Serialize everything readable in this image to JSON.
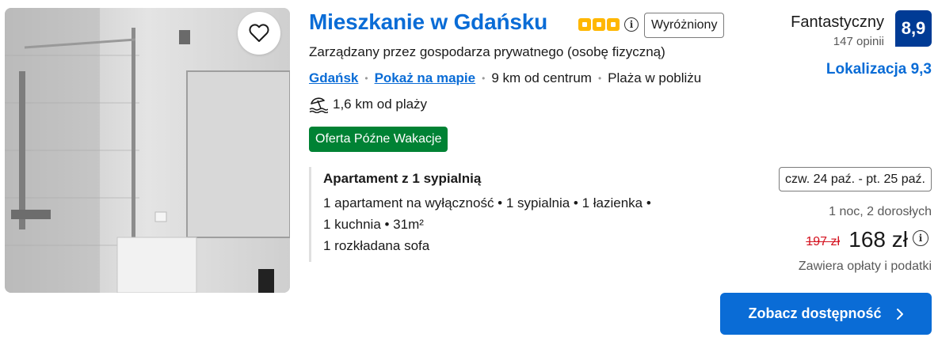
{
  "property": {
    "title": "Mieszkanie w Gdańsku",
    "star_count": 3,
    "featured_label": "Wyróżniony",
    "managed_by": "Zarządzany przez gospodarza prywatnego (osobę fizyczną)",
    "city_link": "Gdańsk",
    "map_link": "Pokaż na mapie",
    "distance_center": "9 km od centrum",
    "beach_nearby": "Plaża w pobliżu",
    "beach_distance": "1,6 km od plaży",
    "deal_badge": "Oferta Późne Wakacje"
  },
  "unit": {
    "title": "Apartament z 1 sypialnią",
    "line1": "1 apartament na wyłączność • 1 sypialnia • 1 łazienka •",
    "line2": "1 kuchnia • 31m²",
    "line3": "1 rozkładana sofa"
  },
  "rating": {
    "word": "Fantastyczny",
    "reviews": "147 opinii",
    "score": "8,9",
    "location_score": "Lokalizacja 9,3"
  },
  "pricing": {
    "dates": "czw. 24 paź. - pt. 25 paź.",
    "nights_guests": "1 noc, 2 dorosłych",
    "old_price": "197 zł",
    "new_price": "168 zł",
    "taxes_note": "Zawiera opłaty i podatki"
  },
  "cta": {
    "label": "Zobacz dostępność"
  },
  "colors": {
    "link_blue": "#0a6cd6",
    "score_navy": "#003b95",
    "star_yellow": "#ffb700",
    "deal_green": "#008234",
    "old_price_red": "#d4111e"
  },
  "icons": [
    "heart-icon",
    "info-icon",
    "beach-umbrella-icon",
    "chevron-right-icon"
  ]
}
